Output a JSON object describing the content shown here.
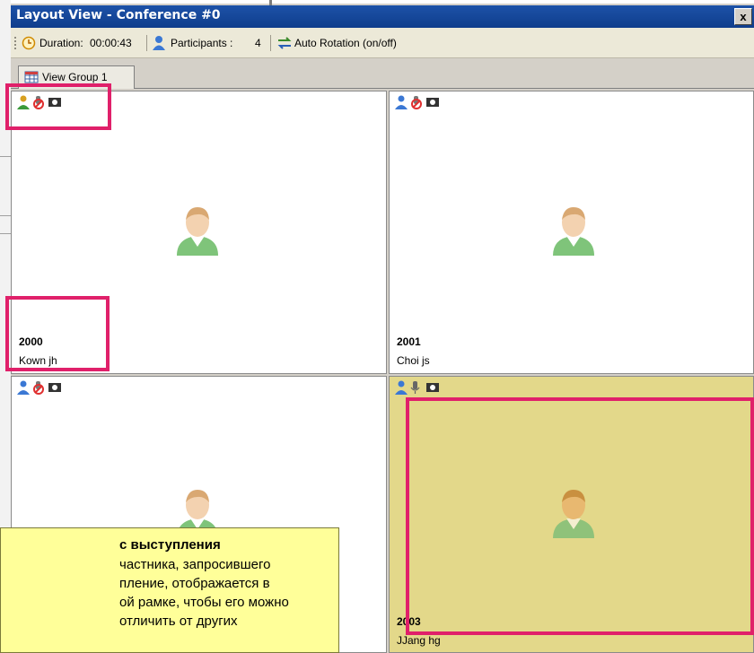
{
  "window": {
    "title": "Layout View - Conference #0",
    "close_label": "x"
  },
  "toolbar": {
    "duration_label": "Duration:",
    "duration_value": "00:00:43",
    "participants_label": "Participants :",
    "participants_value": "4",
    "auto_rotation_label": "Auto Rotation (on/off)"
  },
  "tabs": [
    {
      "label": "View Group 1"
    }
  ],
  "tiles": [
    {
      "number": "2000",
      "name": "Kown jh"
    },
    {
      "number": "2001",
      "name": "Choi js"
    },
    {
      "number": "",
      "name": ""
    },
    {
      "number": "2003",
      "name": "JJang hg"
    }
  ],
  "callout": {
    "title": "с выступления",
    "text": "частника, запросившего\nпление, отображается в\nой рамке, чтобы его можно\nотличить от других"
  },
  "colors": {
    "highlight": "#e0206a",
    "active_tile": "#e3d88a",
    "titlebar": "#1d52a8",
    "callout": "#ffff99"
  }
}
